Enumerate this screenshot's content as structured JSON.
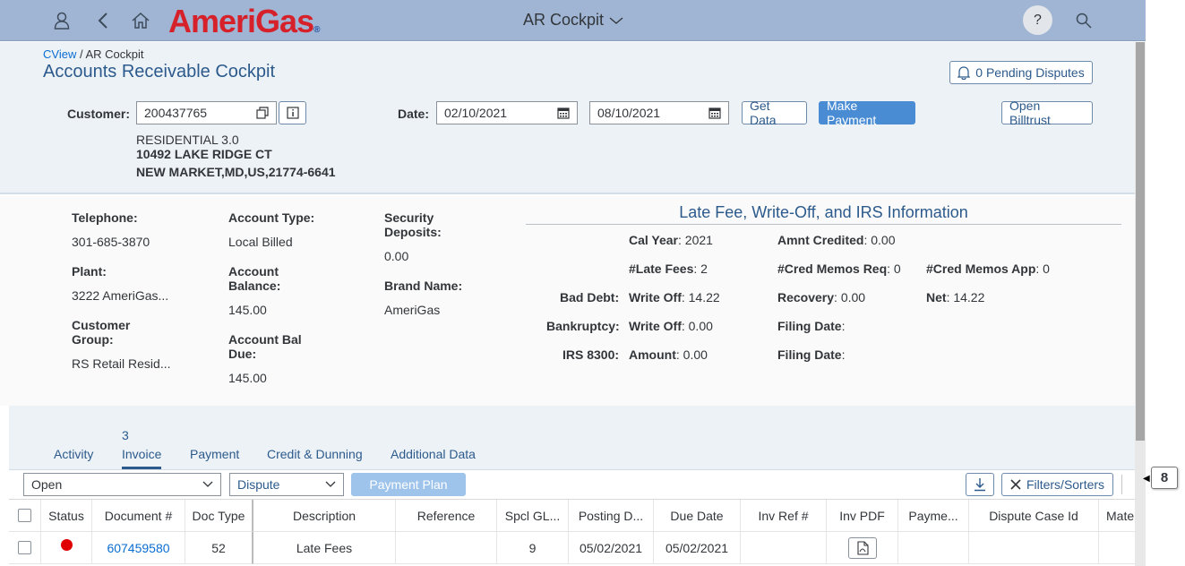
{
  "shell": {
    "logo_text_red": "Ameri",
    "logo_text_blue": "Gas",
    "app_title": "AR Cockpit",
    "help_label": "?"
  },
  "breadcrumb": {
    "link": "CView",
    "current": "AR Cockpit",
    "sep": "/"
  },
  "page_title": "Accounts Receivable Cockpit",
  "pending_disputes": "0 Pending Disputes",
  "customer": {
    "label": "Customer:",
    "value": "200437765",
    "type": "RESIDENTIAL 3.0",
    "address1": "10492 LAKE RIDGE CT",
    "address2": "NEW MARKET,MD,US,21774-6641"
  },
  "date": {
    "label": "Date:",
    "from": "02/10/2021",
    "to": "08/10/2021"
  },
  "buttons": {
    "get_data": "Get Data",
    "make_payment": "Make Payment",
    "open_billtrust": "Open Billtrust"
  },
  "account": {
    "telephone_label": "Telephone:",
    "telephone": "301-685-3870",
    "plant_label": "Plant:",
    "plant": "3222 AmeriGas...",
    "customer_group_label1": "Customer",
    "customer_group_label2": "Group:",
    "customer_group": "RS Retail Resid...",
    "account_type_label": "Account Type:",
    "account_type": "Local Billed",
    "balance_label1": "Account",
    "balance_label2": "Balance:",
    "balance": "145.00",
    "bal_due_label1": "Account Bal",
    "bal_due_label2": "Due:",
    "bal_due": "145.00",
    "security_label1": "Security",
    "security_label2": "Deposits:",
    "security": "0.00",
    "brand_label": "Brand Name:",
    "brand": "AmeriGas"
  },
  "late_fee": {
    "title": "Late Fee, Write-Off, and IRS Information",
    "cal_year_label": "Cal Year",
    "cal_year": ": 2021",
    "amnt_credited_label": "Amnt Credited",
    "amnt_credited": ": 0.00",
    "late_fees_label": "#Late Fees",
    "late_fees": ": 2",
    "cred_req_label": "#Cred Memos Req",
    "cred_req": ": 0",
    "cred_app_label": "#Cred Memos App",
    "cred_app": ": 0",
    "bad_debt_label": "Bad Debt:",
    "write_off_label": "Write Off",
    "bad_debt_write_off": ": 14.22",
    "recovery_label": "Recovery",
    "recovery": ": 0.00",
    "net_label": "Net",
    "net": ": 14.22",
    "bankruptcy_label": "Bankruptcy:",
    "bankruptcy_write_off": ": 0.00",
    "filing_date_label": "Filing Date",
    "filing_date_1": ":",
    "irs_label": "IRS 8300:",
    "amount_label": "Amount",
    "amount": ": 0.00",
    "filing_date_2": ":"
  },
  "tabs": {
    "invoice_count": "3",
    "items": [
      "Activity",
      "Invoice",
      "Payment",
      "Credit & Dunning",
      "Additional Data"
    ]
  },
  "toolbar": {
    "status_filter": "Open",
    "dispute_filter": "Dispute",
    "payment_plan": "Payment Plan",
    "filters_sorters": "Filters/Sorters"
  },
  "table": {
    "columns": [
      "Status",
      "Document #",
      "Doc Type",
      "Description",
      "Reference",
      "Spcl GL...",
      "Posting D...",
      "Due Date",
      "Inv Ref #",
      "Inv PDF",
      "Payme...",
      "Dispute Case Id",
      "Mate"
    ],
    "rows": [
      {
        "status_color": "#e00000",
        "document": "607459580",
        "doc_type": "52",
        "description": "Late Fees",
        "reference": "",
        "spcl_gl": "9",
        "posting": "05/02/2021",
        "due": "05/02/2021",
        "inv_ref": "",
        "payment": "",
        "dispute": ""
      }
    ]
  },
  "badge": "8"
}
